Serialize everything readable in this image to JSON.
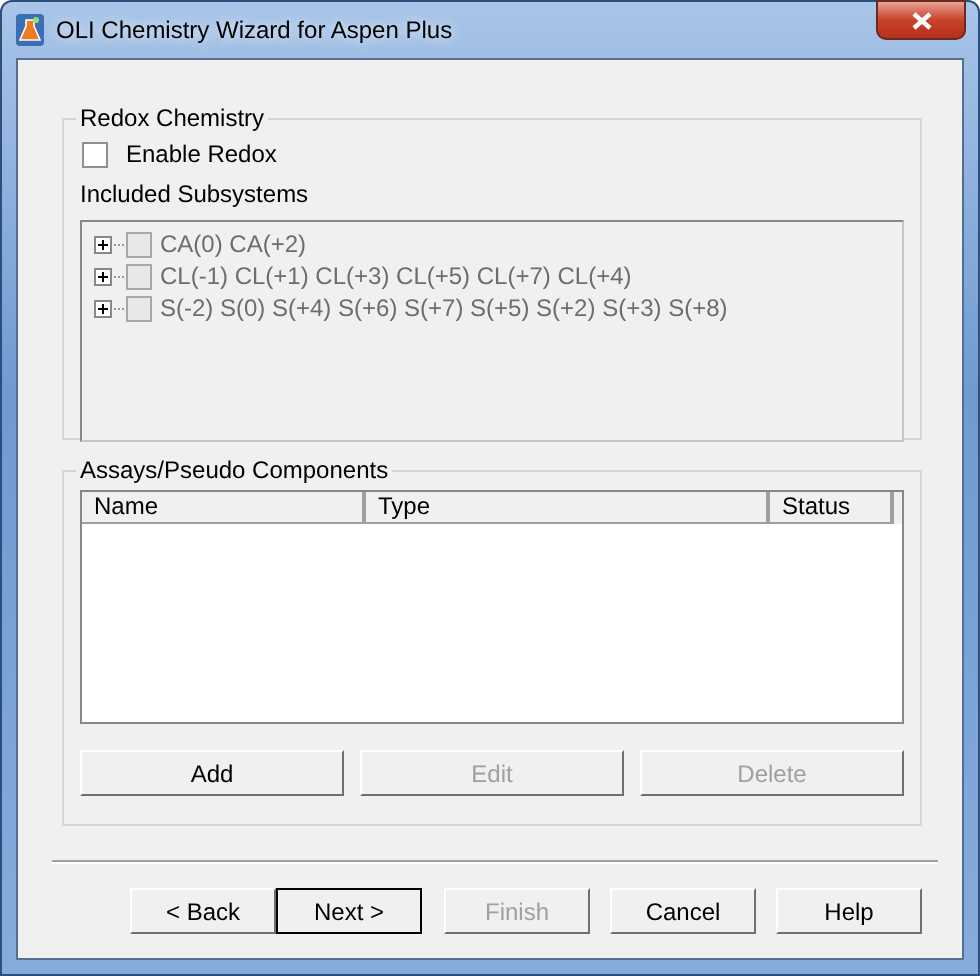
{
  "window": {
    "title": "OLI Chemistry Wizard for Aspen Plus"
  },
  "redox": {
    "title": "Redox Chemistry",
    "enable": {
      "label": "Enable Redox",
      "checked": false
    },
    "subsystems_label": "Included Subsystems",
    "subsystems": [
      {
        "label": "CA(0) CA(+2)",
        "checked": false,
        "expanded": false,
        "disabled": true
      },
      {
        "label": "CL(-1) CL(+1) CL(+3) CL(+5) CL(+7) CL(+4)",
        "checked": false,
        "expanded": false,
        "disabled": true
      },
      {
        "label": "S(-2) S(0) S(+4) S(+6) S(+7) S(+5) S(+2) S(+3) S(+8)",
        "checked": false,
        "expanded": false,
        "disabled": true
      }
    ]
  },
  "assays": {
    "title": "Assays/Pseudo Components",
    "columns": [
      "Name",
      "Type",
      "Status"
    ],
    "buttons": [
      {
        "label": "Add",
        "disabled": false
      },
      {
        "label": "Edit",
        "disabled": true
      },
      {
        "label": "Delete",
        "disabled": true
      }
    ]
  },
  "footer_buttons": [
    {
      "label": "< Back",
      "disabled": false,
      "default": false
    },
    {
      "label": "Next >",
      "disabled": false,
      "default": true
    },
    {
      "label": "Finish",
      "disabled": true,
      "default": false
    },
    {
      "label": "Cancel",
      "disabled": false,
      "default": false
    },
    {
      "label": "Help",
      "disabled": false,
      "default": false
    }
  ]
}
